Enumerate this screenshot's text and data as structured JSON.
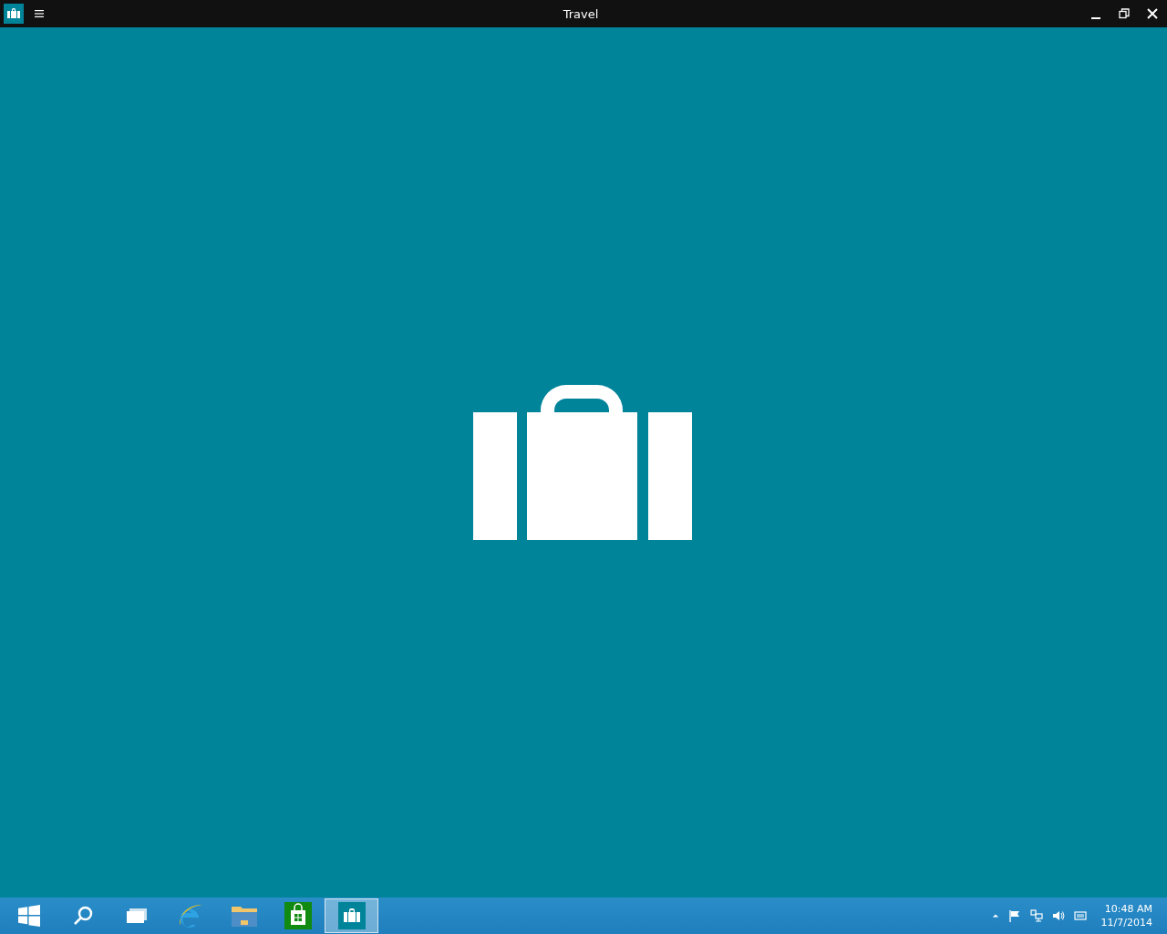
{
  "window": {
    "title": "Travel"
  },
  "taskbar": {
    "items": [
      {
        "kind": "start",
        "selected": false
      },
      {
        "kind": "search",
        "selected": false
      },
      {
        "kind": "taskview",
        "selected": false
      },
      {
        "kind": "browser",
        "selected": false
      },
      {
        "kind": "folder",
        "selected": false
      },
      {
        "kind": "store",
        "selected": false
      },
      {
        "kind": "travel",
        "selected": true
      }
    ],
    "clock": {
      "time": "10:48 AM",
      "date": "11/7/2014"
    }
  }
}
